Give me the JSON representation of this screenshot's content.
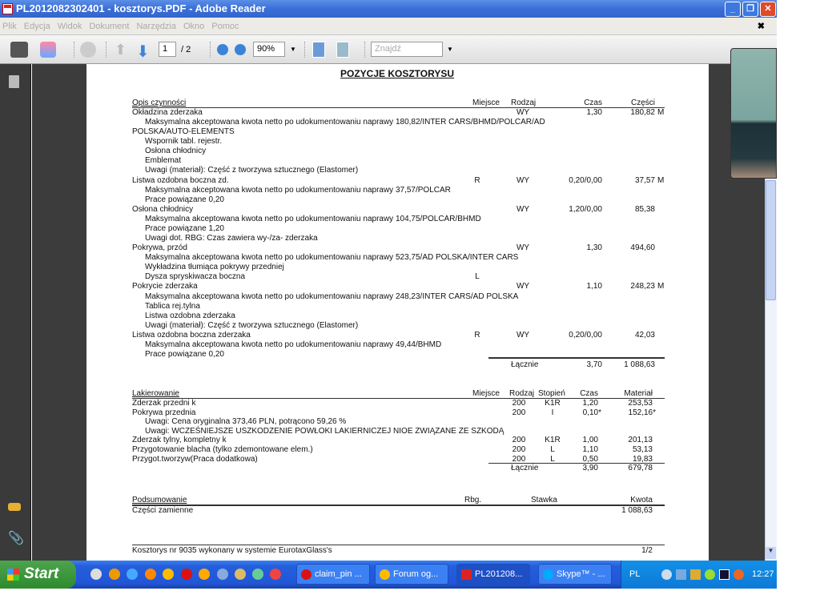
{
  "window": {
    "title": "PL2012082302401 - kosztorys.PDF - Adobe Reader"
  },
  "menu": [
    "Plik",
    "Edycja",
    "Widok",
    "Dokument",
    "Narzędzia",
    "Okno",
    "Pomoc"
  ],
  "toolbar": {
    "page_current": "1",
    "page_total": "/ 2",
    "zoom": "90%",
    "find_placeholder": "Znajdź"
  },
  "doc": {
    "title": "POZYCJE KOSZTORYSU",
    "parts_headers": {
      "desc": "Opis czynności",
      "miejsce": "Miejsce",
      "rodzaj": "Rodzaj",
      "czas": "Czas",
      "czesci": "Części"
    },
    "parts_rows": [
      {
        "desc": "Okładzina zderzaka",
        "rodzaj": "WY",
        "czas": "1,30",
        "czesci": "180,82",
        "suf": "M"
      },
      {
        "desc": "Maksymalna akceptowana kwota netto po udokumentowaniu naprawy  180,82/INTER CARS/BHMD/POLCAR/AD",
        "ind": 1
      },
      {
        "desc": "POLSKA/AUTO-ELEMENTS"
      },
      {
        "desc": "Wspornik tabl. rejestr.",
        "ind": 1
      },
      {
        "desc": "Osłona chłodnicy",
        "ind": 1
      },
      {
        "desc": "Emblemat",
        "ind": 1
      },
      {
        "desc": "Uwagi (materiał): Część z tworzywa sztucznego (Elastomer)",
        "ind": 1
      },
      {
        "desc": "Listwa ozdobna boczna zd.",
        "miejsce": "R",
        "rodzaj": "WY",
        "czas": "0,20/0,00",
        "czesci": "37,57",
        "suf": "M"
      },
      {
        "desc": "Maksymalna akceptowana kwota netto po udokumentowaniu naprawy  37,57/POLCAR",
        "ind": 1
      },
      {
        "desc": "Prace powiązane 0,20",
        "ind": 1
      },
      {
        "desc": "Osłona chłodnicy",
        "rodzaj": "WY",
        "czas": "1,20/0,00",
        "czesci": "85,38"
      },
      {
        "desc": "Maksymalna akceptowana kwota netto po udokumentowaniu naprawy  104,75/POLCAR/BHMD",
        "ind": 1
      },
      {
        "desc": "Prace powiązane 1,20",
        "ind": 1
      },
      {
        "desc": "Uwagi dot. RBG: Czas zawiera wy-/za- zderzaka",
        "ind": 1
      },
      {
        "desc": "Pokrywa, przód",
        "rodzaj": "WY",
        "czas": "1,30",
        "czesci": "494,60"
      },
      {
        "desc": "Maksymalna akceptowana kwota netto po udokumentowaniu naprawy  523,75/AD POLSKA/INTER CARS",
        "ind": 1
      },
      {
        "desc": "Wykładzina tłumiąca pokrywy przedniej",
        "ind": 1
      },
      {
        "desc": "Dysza spryskiwacza boczna",
        "ind": 1,
        "miejsce": "L"
      },
      {
        "desc": "Pokrycie zderzaka",
        "rodzaj": "WY",
        "czas": "1,10",
        "czesci": "248,23",
        "suf": "M"
      },
      {
        "desc": "Maksymalna akceptowana kwota netto po udokumentowaniu naprawy  248,23/INTER CARS/AD POLSKA",
        "ind": 1
      },
      {
        "desc": "Tablica rej.tylna",
        "ind": 1
      },
      {
        "desc": "Listwa ozdobna zderzaka",
        "ind": 1
      },
      {
        "desc": "Uwagi (materiał): Część z tworzywa sztucznego (Elastomer)",
        "ind": 1
      },
      {
        "desc": "Listwa ozdobna boczna zderzaka",
        "miejsce": "R",
        "rodzaj": "WY",
        "czas": "0,20/0,00",
        "czesci": "42,03"
      },
      {
        "desc": "Maksymalna akceptowana kwota netto po udokumentowaniu naprawy  49,44/BHMD",
        "ind": 1
      },
      {
        "desc": "Prace powiązane 0,20",
        "ind": 1
      }
    ],
    "parts_total": {
      "label": "Łącznie",
      "czas": "3,70",
      "czesci": "1 088,63"
    },
    "paint_headers": {
      "desc": "Lakierowanie",
      "miejsce": "Miejsce",
      "rodzaj": "Rodzaj",
      "stopien": "Stopień",
      "czas": "Czas",
      "material": "Materiał"
    },
    "paint_rows": [
      {
        "desc": "Zderzak przedni k",
        "rodzaj": "200",
        "stopien": "K1R",
        "czas": "1,20",
        "material": "253,53"
      },
      {
        "desc": "Pokrywa przednia",
        "rodzaj": "200",
        "stopien": "I",
        "czas": "0,10*",
        "material": "152,16*"
      },
      {
        "desc": "Uwagi: Cena oryginalna 373,46 PLN, potrącono 59,26 %",
        "ind": 1
      },
      {
        "desc": "Uwagi: WCZEŚNIEJSZE USZKODZENIE POWŁOKI LAKIERNICZEJ NIOE ZWIĄZANE ZE SZKODĄ",
        "ind": 1
      },
      {
        "desc": "Zderzak tylny, kompletny k",
        "rodzaj": "200",
        "stopien": "K1R",
        "czas": "1,00",
        "material": "201,13"
      },
      {
        "desc": "Przygotowanie blacha (tylko zdemontowane elem.)",
        "rodzaj": "200",
        "stopien": "L",
        "czas": "1,10",
        "material": "53,13"
      },
      {
        "desc": "Przygot.tworzyw(Praca dodatkowa)",
        "rodzaj": "200",
        "stopien": "L",
        "czas": "0,50",
        "material": "19,83"
      }
    ],
    "paint_total": {
      "label": "Łącznie",
      "czas": "3,90",
      "material": "679,78"
    },
    "summary_headers": {
      "desc": "Podsumowanie",
      "rbg": "Rbg.",
      "stawka": "Stawka",
      "kwota": "Kwota"
    },
    "summary_rows": [
      {
        "desc": "Części zamienne",
        "kwota": "1 088,63"
      }
    ],
    "footer": {
      "text": "Kosztorys nr 9035 wykonany w systemie EurotaxGlass's",
      "page": "1/2"
    }
  },
  "taskbar": {
    "start": "Start",
    "tasks": [
      "claim_pin ...",
      "Forum og...",
      "PL201208...",
      "Skype™ - ..."
    ],
    "lang": "PL",
    "clock": "12:27"
  },
  "colors": {
    "titlebar": "#3a6fd8",
    "taskbar": "#245edb",
    "start": "#2f8a2f"
  }
}
